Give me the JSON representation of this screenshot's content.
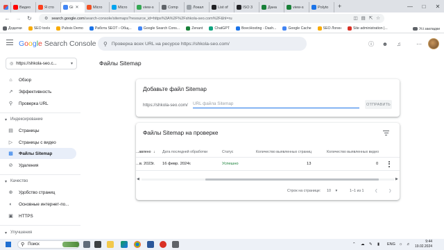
{
  "browser": {
    "tabs": [
      {
        "label": "Видео",
        "icon": "youtube-icon",
        "color": "#ff0000"
      },
      {
        "label": "Я сто",
        "icon": "yandex-icon",
        "color": "#fc3f1d"
      },
      {
        "label": "Gi",
        "icon": "search-console-icon",
        "color": "#4285f4",
        "active": true
      },
      {
        "label": "Micro",
        "icon": "microsoft-icon",
        "color": "#f25022"
      },
      {
        "label": "Micro",
        "icon": "microsoft-icon",
        "color": "#00a4ef"
      },
      {
        "label": "view-s",
        "icon": "page-icon",
        "color": "#34a853"
      },
      {
        "label": "Comp",
        "icon": "page-icon",
        "color": "#5f6368"
      },
      {
        "label": "Локал",
        "icon": "page-icon",
        "color": "#9aa0a6"
      },
      {
        "label": "List of",
        "icon": "wikipedia-icon",
        "color": "#202124"
      },
      {
        "label": "ISO 3",
        "icon": "wikipedia-icon",
        "color": "#202124"
      },
      {
        "label": "Дана",
        "icon": "page-icon",
        "color": "#188038"
      },
      {
        "label": "view-s",
        "icon": "page-icon",
        "color": "#188038"
      },
      {
        "label": "Polyto",
        "icon": "page-icon",
        "color": "#1a73e8"
      }
    ],
    "new_tab": "+",
    "url_host": "search.google.com",
    "url_path": "/search-console/sitemaps?resource_id=https%3A%2F%2Fshkola-seo.com%2F&hl=ru",
    "bookmarks": [
      {
        "label": "Додатки",
        "color": "#5f6368"
      },
      {
        "label": "SEO tools",
        "color": "#f9ab00"
      },
      {
        "label": "Pubsis Demo",
        "color": "#f9ab00"
      },
      {
        "label": "Работа SEOT › Общ...",
        "color": "#1a73e8"
      },
      {
        "label": "Google Search Cons...",
        "color": "#4285f4"
      },
      {
        "label": "Zenant",
        "color": "#188038"
      },
      {
        "label": "ChatGPT",
        "color": "#10a37f"
      },
      {
        "label": "BoecHosting - Dash...",
        "color": "#1a73e8"
      },
      {
        "label": "Google Cache",
        "color": "#4285f4"
      },
      {
        "label": "SEO Логин",
        "color": "#f9ab00"
      },
      {
        "label": "Site administration |...",
        "color": "#d93025"
      }
    ],
    "bookmarks_right": "Усі закладки"
  },
  "header": {
    "logo_google": "Google",
    "logo_product": "Search Console",
    "search_placeholder": "Проверка всех URL на ресурсе https://shkola-seo.com/",
    "accent_color": "#1a73e8"
  },
  "sidebar": {
    "property": "https://shkola-seo.c...",
    "items": [
      {
        "label": "Обзор",
        "icon": "home-icon"
      },
      {
        "label": "Эффективность",
        "icon": "trending-up-icon"
      },
      {
        "label": "Проверка URL",
        "icon": "search-icon"
      }
    ],
    "section_indexing": "Индексирование",
    "indexing_items": [
      {
        "label": "Страницы",
        "icon": "pages-icon"
      },
      {
        "label": "Страницы с видео",
        "icon": "video-pages-icon"
      },
      {
        "label": "Файлы Sitemap",
        "icon": "sitemap-icon",
        "active": true
      },
      {
        "label": "Удаления",
        "icon": "removals-icon"
      }
    ],
    "section_quality": "Качество",
    "quality_items": [
      {
        "label": "Удобство страниц",
        "icon": "page-experience-icon"
      },
      {
        "label": "Основные интернет-по...",
        "icon": "web-vitals-icon"
      },
      {
        "label": "HTTPS",
        "icon": "lock-icon"
      }
    ],
    "section_improvements": "Улучшения"
  },
  "main": {
    "page_title": "Файлы Sitemap",
    "add_card": {
      "title": "Добавьте файл Sitemap",
      "prefix": "https://shkola-seo.com/",
      "placeholder": "URL файла Sitemap",
      "submit_label": "ОТПРАВИТЬ"
    },
    "submitted_card": {
      "title": "Файлы Sitemap на проверке",
      "columns": [
        "...авлено",
        "Дата последней обработки",
        "Статус",
        "Количество выявленных страниц",
        "Количество выявленных видео"
      ],
      "rows": [
        {
          "submitted": "...в. 2023г.",
          "last_read": "16 февр. 2024г.",
          "status": "Успешно",
          "pages": "13",
          "videos": "0"
        }
      ],
      "rows_per_page_label": "Строк на странице:",
      "rows_per_page": "10",
      "range": "1–1 из 1"
    }
  },
  "taskbar": {
    "search_label": "Поиск",
    "lang": "ENG",
    "time": "9:44",
    "date": "19.02.2024"
  }
}
